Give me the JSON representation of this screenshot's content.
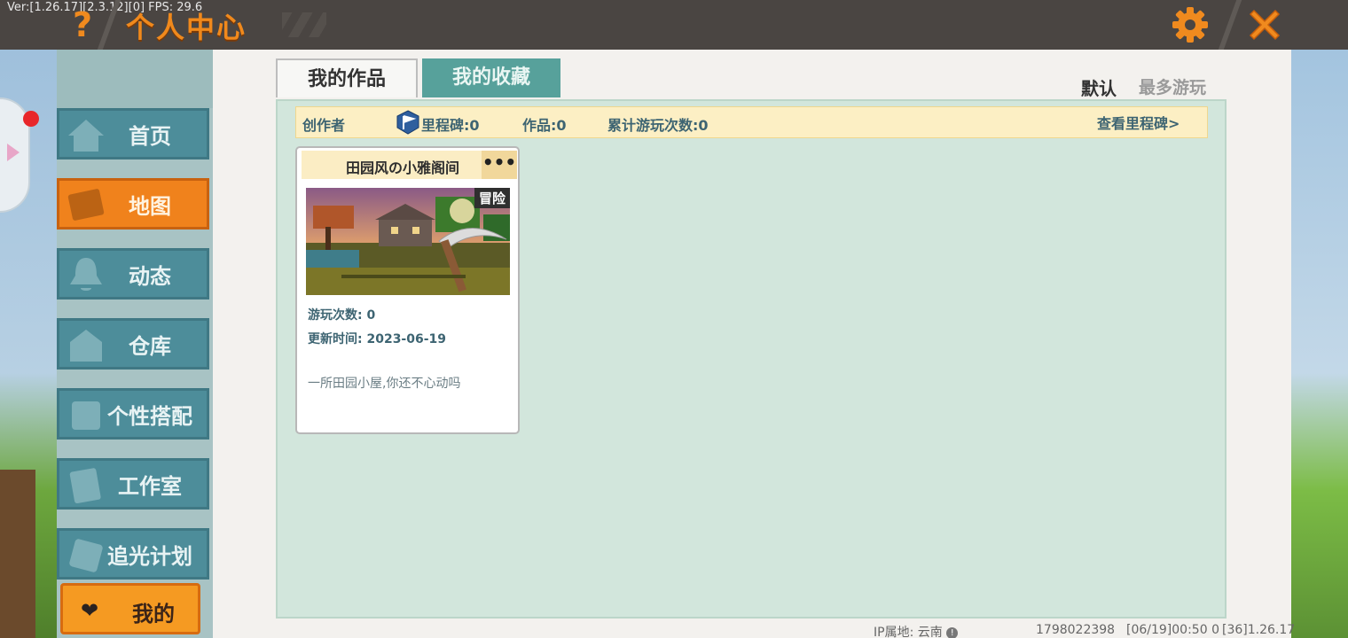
{
  "version_text": "Ver:[1.26.17][2.3.12][0] FPS: 29.6",
  "header": {
    "help_label": "?",
    "title": "个人中心"
  },
  "nav": {
    "items": [
      {
        "label": "首页",
        "icon": "home-icon"
      },
      {
        "label": "地图",
        "icon": "map-icon",
        "active": true
      },
      {
        "label": "动态",
        "icon": "bell-icon"
      },
      {
        "label": "仓库",
        "icon": "house-icon"
      },
      {
        "label": "个性搭配",
        "icon": "avatar-icon"
      },
      {
        "label": "工作室",
        "icon": "studio-icon"
      },
      {
        "label": "追光计划",
        "icon": "plan-icon"
      }
    ],
    "mine_label": "我的"
  },
  "tabs": {
    "works": "我的作品",
    "favorites": "我的收藏"
  },
  "sort": {
    "default": "默认",
    "most_played": "最多游玩"
  },
  "infobar": {
    "creator": "创作者",
    "milestone": "里程碑:0",
    "works": "作品:0",
    "total_plays": "累计游玩次数:0",
    "view_milestone": "查看里程碑>"
  },
  "card": {
    "title": "田园风の小雅阁间",
    "more": "•••",
    "tag": "冒险",
    "plays": "游玩次数: 0",
    "updated": "更新时间: 2023-06-19",
    "description": "一所田园小屋,你还不心动吗"
  },
  "footer": {
    "ip_label": "IP属地: 云南",
    "user_id": "1798022398",
    "time_info": "[06/19]00:50 0",
    "build": "[36]1.26.17"
  },
  "colors": {
    "accent": "#f0821c",
    "nav_teal": "#4d8d9a",
    "content_bg": "#d2e6dc"
  }
}
